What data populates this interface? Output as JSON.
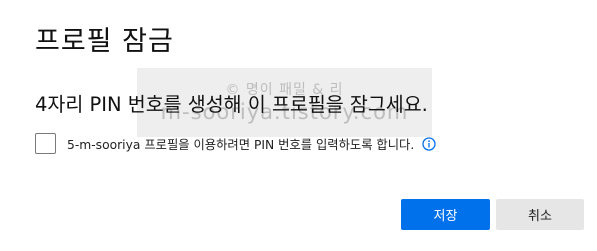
{
  "dialog": {
    "title": "프로필 잠금",
    "subtitle": "4자리 PIN 번호를 생성해 이 프로필을 잠그세요.",
    "checkbox_label": "5-m-sooriya 프로필을 이용하려면 PIN 번호를 입력하도록 합니다.",
    "checkbox_checked": false,
    "info_icon": "info-circle-icon"
  },
  "buttons": {
    "save_label": "저장",
    "cancel_label": "취소"
  },
  "watermark": {
    "top_text": "© 명이 패밀 & 리",
    "bottom_text": "m-sooriya.tistory.com"
  },
  "colors": {
    "primary": "#0071eb",
    "secondary_button": "#e6e6e6",
    "info_icon": "#0071eb"
  }
}
